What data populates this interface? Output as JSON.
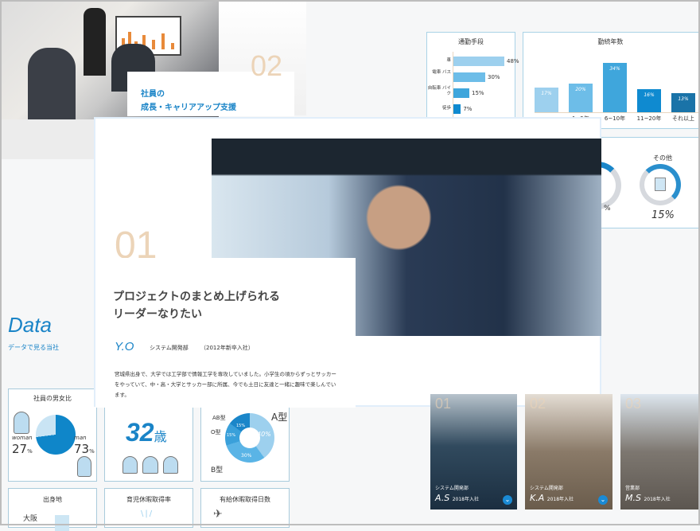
{
  "feature2": {
    "number": "02",
    "title_line1": "社員の",
    "title_line2": "成長・キャリアアップ支援"
  },
  "feature1": {
    "number": "01",
    "headline_line1": "プロジェクトのまとめ上げられる",
    "headline_line2": "リーダーなりたい",
    "initials": "Y.O",
    "department": "システム開発部",
    "joined": "（2012年新卒入社）",
    "body": "宮城県出身で、大学では工学部で情報工学を専攻していました。小学生の頃からずっとサッカーをやっていて、中・高・大学とサッカー部に所属、今でも土日に友達と一緒に趣味で楽しんでいます。"
  },
  "data_section": {
    "title": "Data",
    "subtitle": "データで見る当社"
  },
  "chart_data": [
    {
      "type": "bar",
      "title": "通勤手段",
      "orientation": "horizontal",
      "categories": [
        "車",
        "電車 バス",
        "自転車 バイク",
        "徒歩"
      ],
      "values": [
        48,
        30,
        15,
        7
      ],
      "labels": [
        "48%",
        "30%",
        "15%",
        "7%"
      ],
      "colors": [
        "#9dd0ee",
        "#6dbde8",
        "#3fa6dc",
        "#0f8ad0"
      ]
    },
    {
      "type": "bar",
      "title": "勤続年数",
      "categories": [
        "",
        "1~5年",
        "6~10年",
        "11~20年",
        "それ以上"
      ],
      "values": [
        17,
        20,
        34,
        16,
        13
      ],
      "labels": [
        "17%",
        "20%",
        "34%",
        "16%",
        "13%"
      ],
      "colors": [
        "#9dd0ee",
        "#6dbde8",
        "#3fa6dc",
        "#0f8ad0",
        "#1a73a8"
      ]
    },
    {
      "type": "pie",
      "title": "社員の男女比",
      "categories": [
        "woman",
        "man"
      ],
      "values": [
        27,
        73
      ],
      "labels": [
        "27%",
        "73%"
      ],
      "colors": [
        "#c9e4f4",
        "#0f86c9"
      ]
    },
    {
      "type": "pie",
      "categories": [
        "A型",
        "B型",
        "O型",
        "AB型"
      ],
      "values": [
        40,
        30,
        15,
        15
      ],
      "labels": [
        "40%",
        "30%",
        "15%",
        "15%"
      ],
      "colors": [
        "#9dd0ee",
        "#5ab4e6",
        "#3aa0da",
        "#1a86c9"
      ]
    }
  ],
  "other_stat": {
    "label": "その他",
    "value": "15%",
    "partial_value": "%"
  },
  "avg_age": {
    "number": "32",
    "unit": "歳"
  },
  "gender": {
    "title": "社員の男女比",
    "woman_label": "woman",
    "woman_value": "27",
    "man_label": "man",
    "man_value": "73",
    "unit": "%"
  },
  "blood": {
    "a": "A型",
    "b": "B型",
    "o": "O型",
    "ab": "AB型"
  },
  "bottom_cards": [
    {
      "title": "出身地",
      "sub": "大阪"
    },
    {
      "title": "育児休暇取得率"
    },
    {
      "title": "有給休暇取得日数"
    }
  ],
  "staff": [
    {
      "number": "01",
      "dept": "システム開発部",
      "initials": "A.S",
      "year": "2018年入社"
    },
    {
      "number": "02",
      "dept": "システム開発部",
      "initials": "K.A",
      "year": "2018年入社"
    },
    {
      "number": "03",
      "dept": "営業部",
      "initials": "M.S",
      "year": "2018年入社"
    }
  ]
}
